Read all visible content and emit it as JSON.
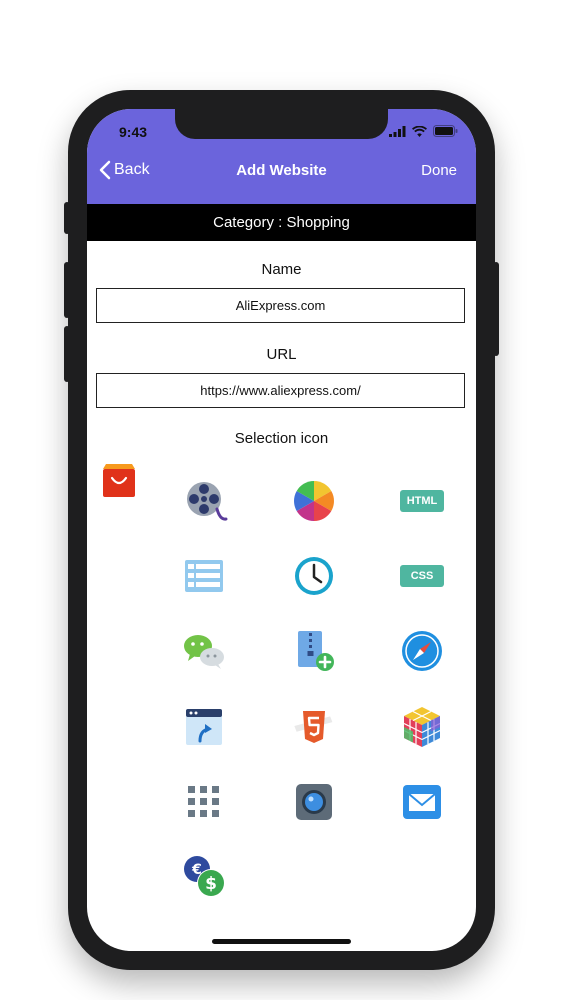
{
  "status": {
    "time": "9:43"
  },
  "nav": {
    "back": "Back",
    "title": "Add Website",
    "done": "Done"
  },
  "category": {
    "text": "Category : Shopping"
  },
  "form": {
    "name_label": "Name",
    "name_value": "AliExpress.com",
    "url_label": "URL",
    "url_value": "https://www.aliexpress.com/",
    "selection_label": "Selection icon"
  },
  "icons": {
    "html_text": "HTML",
    "css_text": "CSS",
    "list": [
      "shopping-bag-icon",
      "film-reel-icon",
      "color-wheel-icon",
      "html-icon",
      "table-icon",
      "clock-icon",
      "css-icon",
      "wechat-icon",
      "zip-add-icon",
      "compass-icon",
      "browser-upload-icon",
      "html5-icon",
      "rubiks-cube-icon",
      "grid-icon",
      "camera-icon",
      "mail-icon",
      "currency-exchange-icon"
    ]
  },
  "colors": {
    "accent": "#6b64dc",
    "category_bar": "#000000"
  }
}
